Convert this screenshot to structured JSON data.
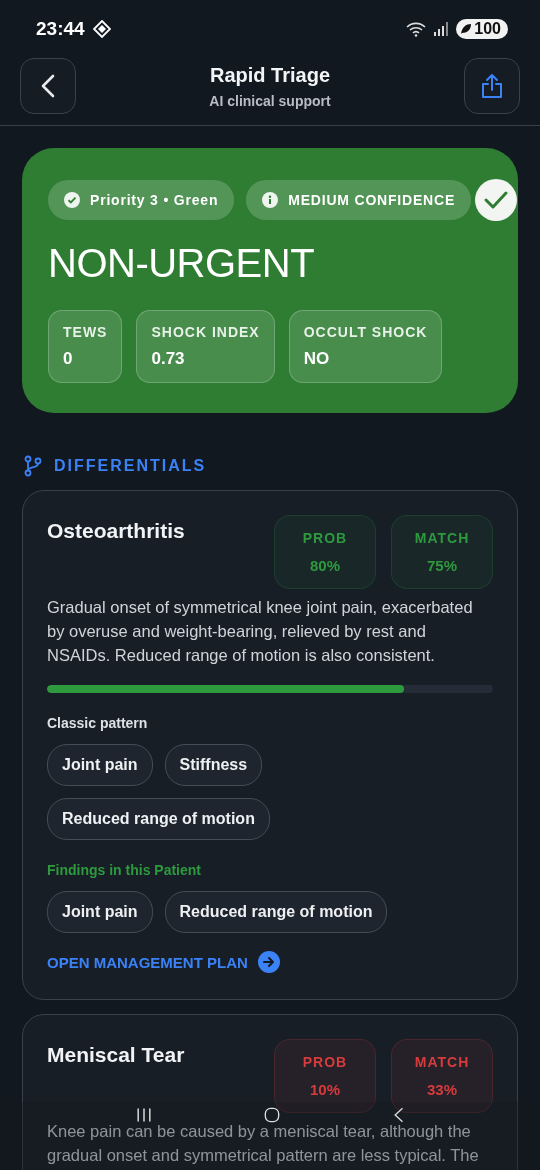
{
  "status_bar": {
    "time": "23:44",
    "battery": "100"
  },
  "header": {
    "title": "Rapid Triage",
    "subtitle": "AI clinical support"
  },
  "triage": {
    "priority": "Priority 3 • Green",
    "confidence": "MEDIUM CONFIDENCE",
    "category": "NON-URGENT",
    "metrics": [
      {
        "label": "TEWS",
        "value": "0"
      },
      {
        "label": "SHOCK INDEX",
        "value": "0.73"
      },
      {
        "label": "OCCULT SHOCK",
        "value": "NO"
      }
    ]
  },
  "differentials": {
    "heading": "DIFFERENTIALS",
    "items": [
      {
        "name": "Osteoarthritis",
        "color": "#2e9a3e",
        "prob_label": "PROB",
        "prob": "80%",
        "match_label": "MATCH",
        "match": "75%",
        "description": "Gradual onset of symmetrical knee joint pain, exacerbated by overuse and weight-bearing, relieved by rest and NSAIDs. Reduced range of motion is also consistent.",
        "level": 0.8,
        "classic_label": "Classic pattern",
        "classic": [
          "Joint pain",
          "Stiffness",
          "Reduced range of motion"
        ],
        "findings_label": "Findings in this Patient",
        "findings": [
          "Joint pain",
          "Reduced range of motion"
        ],
        "link": "OPEN MANAGEMENT PLAN"
      },
      {
        "name": "Meniscal Tear",
        "color": "#d63c3c",
        "prob_label": "PROB",
        "prob": "10%",
        "match_label": "MATCH",
        "match": "33%",
        "description": "Knee pain can be caused by a meniscal tear, although the gradual onset and symmetrical pattern are less typical. The"
      }
    ]
  }
}
